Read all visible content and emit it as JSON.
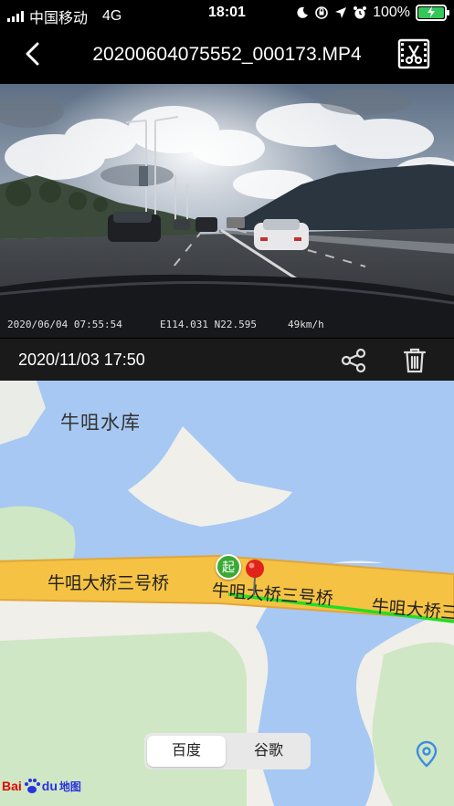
{
  "status_bar": {
    "carrier": "中国移动",
    "network": "4G",
    "time": "18:01",
    "battery": "100%"
  },
  "header": {
    "title": "20200604075552_000173.MP4"
  },
  "video": {
    "osd_timestamp": "2020/06/04 07:55:54",
    "osd_coords": "E114.031 N22.595",
    "osd_speed": "49km/h"
  },
  "info_bar": {
    "date": "2020/11/03 17:50"
  },
  "map": {
    "labels": {
      "reservoir": "牛咀水库",
      "bridge_left": "牛咀大桥三号桥",
      "bridge_middle": "牛咀大桥三号桥",
      "bridge_right": "牛咀大桥三"
    },
    "start_marker": "起",
    "provider_tabs": {
      "baidu": "百度",
      "google": "谷歌"
    },
    "logo": {
      "bai": "Bai",
      "du": "du",
      "ditu": "地图"
    }
  },
  "colors": {
    "road_fill": "#f5c243",
    "road_border": "#e0a63a",
    "water": "#a7c8f2",
    "land": "#f1efe9",
    "park": "#cfe7c4",
    "track": "#22dd22",
    "pin_red": "#e0241b",
    "start_green": "#3aa935"
  }
}
